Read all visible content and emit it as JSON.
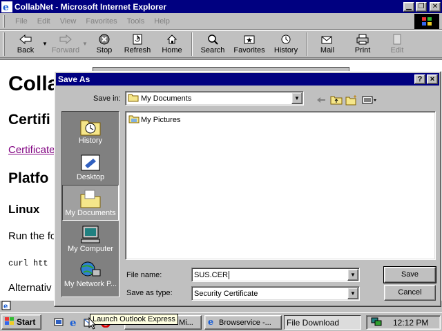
{
  "ie": {
    "title": "CollabNet - Microsoft Internet Explorer",
    "menu": [
      "File",
      "Edit",
      "View",
      "Favorites",
      "Tools",
      "Help"
    ],
    "toolbar": {
      "back": "Back",
      "forward": "Forward",
      "stop": "Stop",
      "refresh": "Refresh",
      "home": "Home",
      "search": "Search",
      "favorites": "Favorites",
      "history": "History",
      "mail": "Mail",
      "print": "Print",
      "edit": "Edit"
    }
  },
  "page": {
    "h1": "Colla",
    "h2a": "Certifi",
    "link": "Certificate",
    "h2b": "Platfo",
    "h3": "Linux",
    "p1": "Run the fo",
    "code": "curl htt",
    "p2": "Alternativ"
  },
  "dialog": {
    "title": "Save As",
    "help_btn": "?",
    "close_btn": "×",
    "save_in_label": "Save in:",
    "save_in_value": "My Documents",
    "places": [
      {
        "label": "History",
        "icon": "history-icon"
      },
      {
        "label": "Desktop",
        "icon": "desktop-icon"
      },
      {
        "label": "My Documents",
        "icon": "my-documents-icon"
      },
      {
        "label": "My Computer",
        "icon": "my-computer-icon"
      },
      {
        "label": "My Network P...",
        "icon": "my-network-places-icon"
      }
    ],
    "active_place": "My Documents",
    "files": [
      {
        "name": "My Pictures",
        "icon": "folder-icon"
      }
    ],
    "file_name_label": "File name:",
    "file_name_value": "SUS.CER",
    "save_as_type_label": "Save as type:",
    "save_as_type_value": "Security Certificate",
    "save_btn": "Save",
    "cancel_btn": "Cancel"
  },
  "taskbar": {
    "start": "Start",
    "tooltip": "Launch Outlook Express",
    "tasks": [
      "CollabNet - Mi...",
      "Browservice -...",
      "File Download"
    ],
    "clock": "12:12 PM"
  },
  "colors": {
    "titlebar": "#000080",
    "face": "#c0c0c0",
    "visited_link": "#800080"
  }
}
